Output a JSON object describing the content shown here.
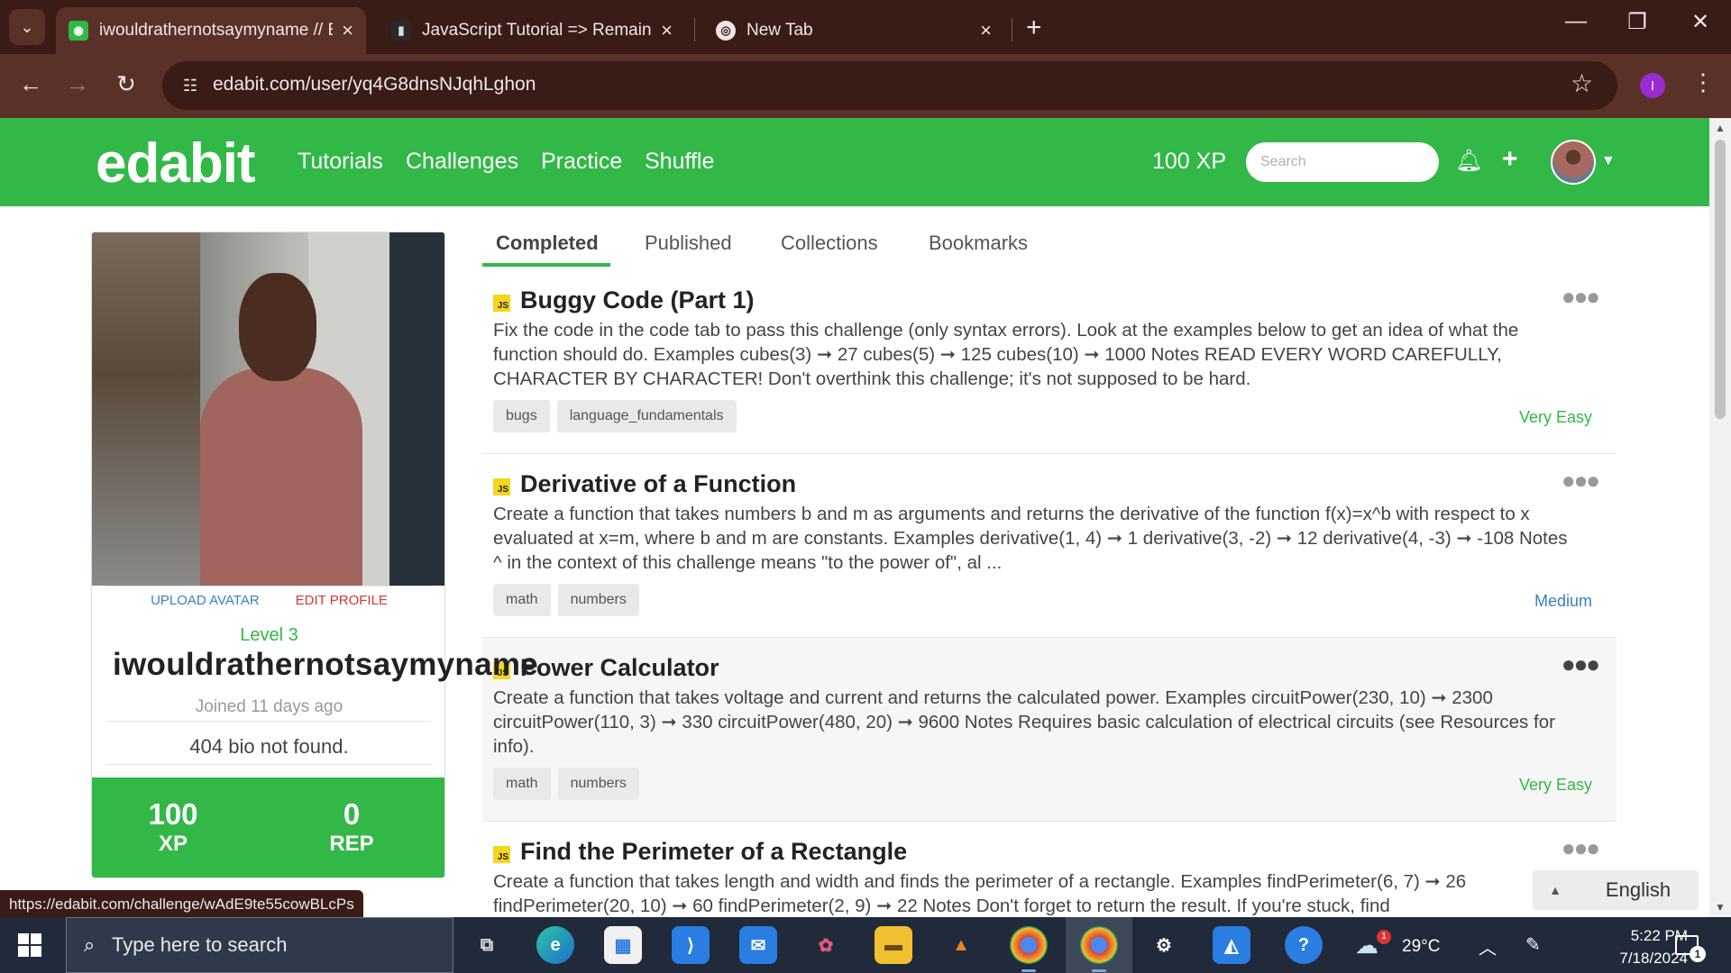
{
  "browser": {
    "tabs": [
      {
        "title": "iwouldrathernotsaymyname // E",
        "favicon": "edabit-favicon",
        "active": true
      },
      {
        "title": "JavaScript Tutorial => Remaind",
        "favicon": "tutorial-favicon",
        "active": false
      },
      {
        "title": "New Tab",
        "favicon": "chrome-icon",
        "active": false
      }
    ],
    "url": "edabit.com/user/yq4G8dnsNJqhLghon",
    "profile_initial": "I",
    "status_url": "https://edabit.com/challenge/wAdE9te55cowBLcPs"
  },
  "header": {
    "logo": "edabit",
    "nav": [
      "Tutorials",
      "Challenges",
      "Practice",
      "Shuffle"
    ],
    "xp": "100 XP",
    "search_placeholder": "Search"
  },
  "profile": {
    "upload_avatar": "UPLOAD AVATAR",
    "edit_profile": "EDIT PROFILE",
    "level": "Level 3",
    "username": "iwouldrathernotsaymyname",
    "joined": "Joined 11 days ago",
    "bio": "404 bio not found.",
    "xp_value": "100",
    "xp_label": "XP",
    "rep_value": "0",
    "rep_label": "REP"
  },
  "profile_tabs": [
    "Completed",
    "Published",
    "Collections",
    "Bookmarks"
  ],
  "challenges": [
    {
      "badge": "JS",
      "title": "Buggy Code (Part 1)",
      "description": "Fix the code in the code tab to pass this challenge (only syntax errors). Look at the examples below to get an idea of what the function should do. Examples cubes(3) ➞ 27 cubes(5) ➞ 125 cubes(10) ➞ 1000 Notes READ EVERY WORD CAREFULLY, CHARACTER BY CHARACTER! Don't overthink this challenge; it's not supposed to be hard.",
      "tags": [
        "bugs",
        "language_fundamentals"
      ],
      "difficulty": "Very Easy"
    },
    {
      "badge": "JS",
      "title": "Derivative of a Function",
      "description": "Create a function that takes numbers b and m as arguments and returns the derivative of the function f(x)=x^b with respect to x evaluated at x=m, where b and m are constants. Examples derivative(1, 4) ➞ 1 derivative(3, -2) ➞ 12 derivative(4, -3) ➞ -108 Notes ^ in the context of this challenge means \"to the power of\", al ...",
      "tags": [
        "math",
        "numbers"
      ],
      "difficulty": "Medium"
    },
    {
      "badge": "JS",
      "title": "Power Calculator",
      "description": "Create a function that takes voltage and current and returns the calculated power. Examples circuitPower(230, 10) ➞ 2300 circuitPower(110, 3) ➞ 330 circuitPower(480, 20) ➞ 9600 Notes Requires basic calculation of electrical circuits (see Resources for info).",
      "tags": [
        "math",
        "numbers"
      ],
      "difficulty": "Very Easy"
    },
    {
      "badge": "JS",
      "title": "Find the Perimeter of a Rectangle",
      "description": "Create a function that takes length and width and finds the perimeter of a rectangle. Examples findPerimeter(6, 7) ➞ 26 findPerimeter(20, 10) ➞ 60 findPerimeter(2, 9) ➞ 22 Notes Don't forget to return the result. If you're stuck, find",
      "tags": [],
      "difficulty": ""
    }
  ],
  "language_button": "English",
  "taskbar": {
    "search_placeholder": "Type here to search",
    "temperature": "29°C",
    "weather_badge": "1",
    "time": "5:22 PM",
    "date": "7/18/2024",
    "notification_count": "1"
  }
}
